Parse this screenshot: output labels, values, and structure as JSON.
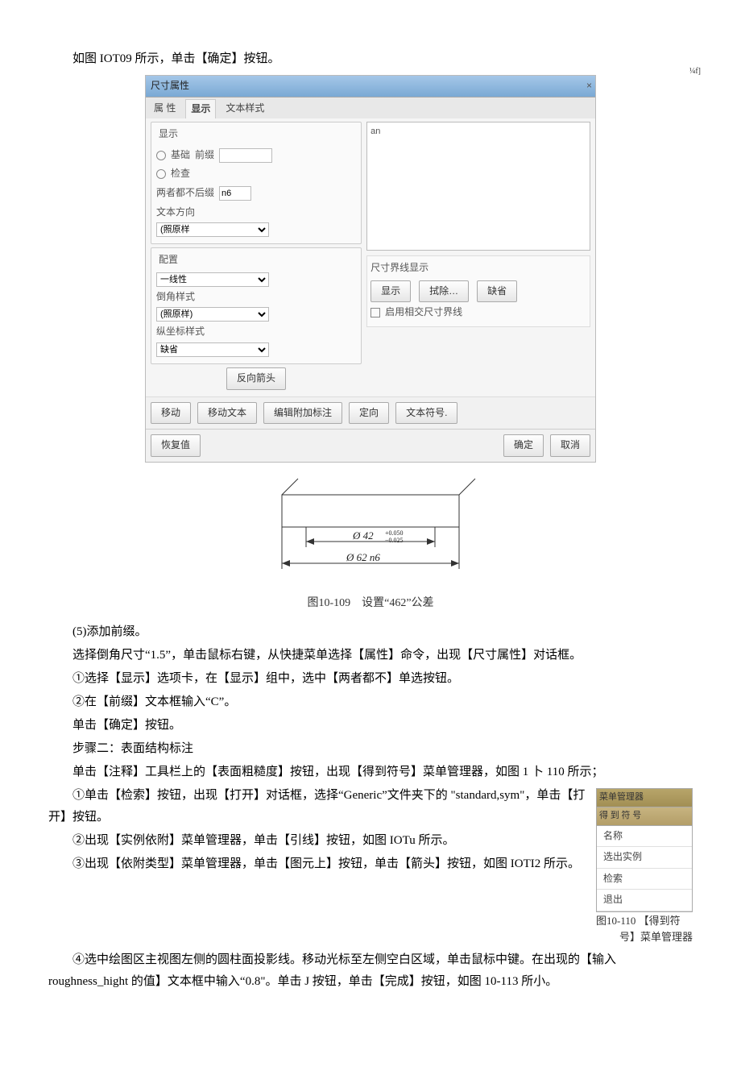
{
  "top_mark": "¼f]",
  "p_intro": "如图 IOT09 所示，单击【确定】按钮。",
  "dialog": {
    "title": "尺寸属性",
    "tabs": {
      "t1": "属 性",
      "t2": "显示",
      "t3": "文本样式"
    },
    "group_show": "显示",
    "radio_basic": "基础",
    "label_prefix": "前缀",
    "radio_check": "检查",
    "label_both_no_suffix": "两者都不后缀",
    "suffix_value": "n6",
    "label_text_dir": "文本方向",
    "val_same": "(照原样",
    "group_config": "配置",
    "val_linear": "一线性",
    "label_chamfer_style": "倒角样式",
    "val_same2": "(照原样)",
    "label_ord_style": "纵坐标样式",
    "val_default": "缺省",
    "btn_reverse_arrow": "反向箭头",
    "right_text_initial": "an",
    "group_ext_line": "尺寸界线显示",
    "btn_show": "显示",
    "btn_remove": "拭除…",
    "btn_default": "缺省",
    "check_enable_intersect": "启用相交尺寸界线",
    "btn_move": "移动",
    "btn_move_text": "移动文本",
    "btn_edit_attach": "编辑附加标注",
    "btn_orient": "定向",
    "btn_text_symbol": "文本符号.",
    "btn_restore": "恢复值",
    "btn_ok": "确定",
    "btn_cancel": "取消"
  },
  "figure": {
    "dim1_left": "Ø 42",
    "dim1_top": "+0.050",
    "dim1_bot": "−0.025",
    "dim2": "Ø 62 n6",
    "caption": "图10-109　设置“462”公差"
  },
  "p5": "(5)添加前缀。",
  "p5a": "选择倒角尺寸“1.5”，单击鼠标右键，从快捷菜单选择【属性】命令，出现【尺寸属性】对话框。",
  "p5b": "①选择【显示】选项卡，在【显示】组中，选中【两者都不】单选按钮。",
  "p5c": "②在【前缀】文本框输入“C”。",
  "p5d": "单击【确定】按钮。",
  "p_step2": "步骤二：表面结构标注",
  "p_step2a": "单击【注释】工具栏上的【表面粗糙度】按钮，出现【得到符号】菜单管理器，如图 1 卜 110 所示；",
  "p_step2b": "①单击【检索】按钮，出现【打开】对话框，选择“Generic”文件夹下的 \"standard,sym\"，单击【打开】按钮。",
  "p_step2c": "②出现【实例依附】菜单管理器，单击【引线】按钮，如图 IOTu 所示。",
  "p_step2d": "③出现【依附类型】菜单管理器，单击【图元上】按钮，单击【箭头】按钮，如图 IOTI2 所示。",
  "p_step2e": "④选中绘图区主视图左侧的圆柱面投影线。移动光标至左侧空白区域，单击鼠标中键。在出现的【输入 roughness_hight 的值】文本框中输入“0.8\"。单击 J 按钮，单击【完成】按钮，如图 10-113 所小。",
  "float_menu": {
    "hdr1": "菜单管理器",
    "hdr2": "得 到 符 号",
    "mi1": "名称",
    "mi2": "选出实例",
    "mi3": "检索",
    "mi4": "退出",
    "caption1": "图10-110 【得到符",
    "caption2": "号】菜单管理器"
  }
}
